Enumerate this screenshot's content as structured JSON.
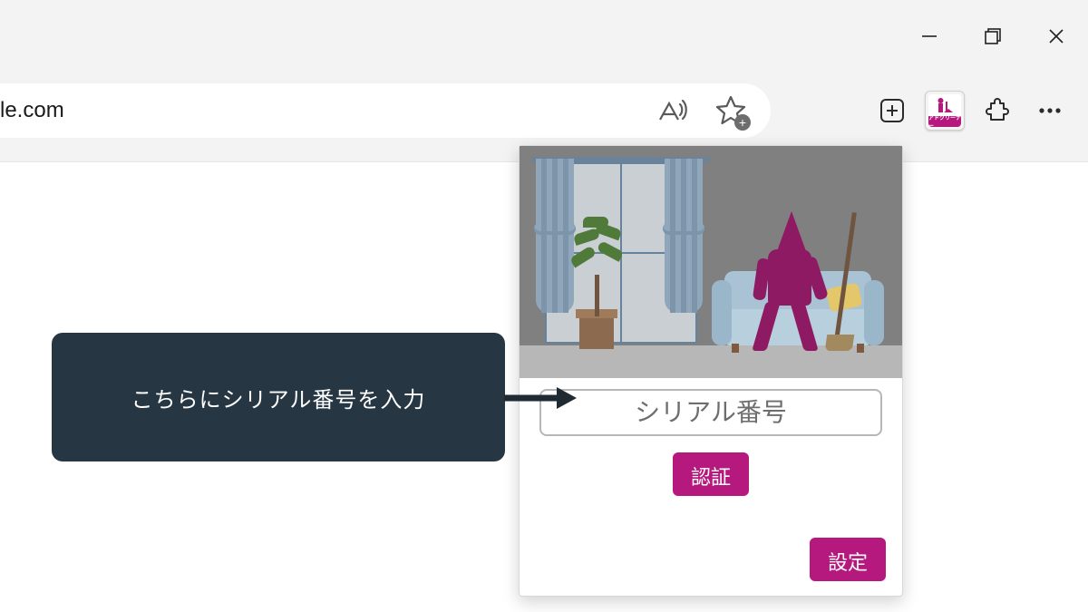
{
  "window_controls": {
    "minimize": "minimize",
    "maximize": "maximize",
    "close": "close"
  },
  "address_bar": {
    "url_fragment": "le.com"
  },
  "toolbar_icons": {
    "read_aloud": "read-aloud",
    "favorite": "add-favorite",
    "new_tab_action": "new-tab-action",
    "extension_label": "アドクリーナー",
    "extensions": "extensions",
    "more": "more"
  },
  "callout": {
    "text": "こちらにシリアル番号を入力"
  },
  "popup": {
    "serial_placeholder": "シリアル番号",
    "serial_value": "",
    "auth_button": "認証",
    "settings_button": "設定"
  }
}
